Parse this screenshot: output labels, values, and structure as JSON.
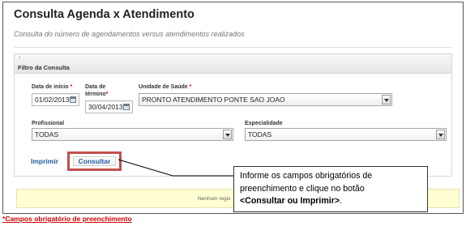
{
  "page": {
    "title": "Consulta Agenda x Atendimento",
    "subtitle": "Consulta do número de agendamentos versus atendimentos realizados"
  },
  "filter": {
    "panel_title": "Filtro da Consulta",
    "collapse_glyph": "›",
    "data_inicio": {
      "label": "Data de início",
      "value": "01/02/2013"
    },
    "data_termino": {
      "label_line1": "Data de",
      "label_line2": "término",
      "value": "30/04/2013"
    },
    "unidade": {
      "label": "Unidade de Saúde",
      "value": "PRONTO ATENDIMENTO PONTE SAO JOAO"
    },
    "profissional": {
      "label": "Profissional",
      "value": "TODAS"
    },
    "especialidade": {
      "label": "Especialidade",
      "value": "TODAS"
    },
    "required_mark": "*"
  },
  "actions": {
    "imprimir": "Imprimir",
    "consultar": "Consultar"
  },
  "notice": {
    "text": "Nenhum regis"
  },
  "callout": {
    "line1": "Informe os campos obrigatórios de",
    "line2": "preenchimento e clique no botão",
    "bold": "<Consultar ou Imprimir>",
    "end": "."
  },
  "footer": {
    "mark": "*",
    "text": "Campos obrigatório de preenchimento"
  },
  "colors": {
    "highlight_border": "#c0504d",
    "required": "#dd0000",
    "button_text": "#1f5fa0",
    "notice_bg": "#ffffd2"
  },
  "icons": [
    "calendar-icon",
    "chevron-down-icon",
    "collapse-chevron-icon"
  ]
}
